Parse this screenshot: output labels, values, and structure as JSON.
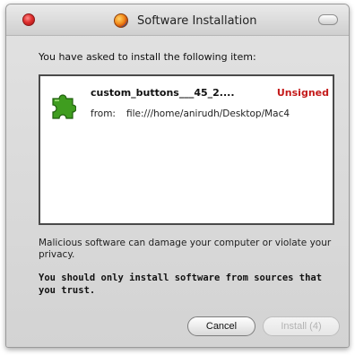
{
  "window": {
    "title": "Software Installation"
  },
  "prompt": "You have asked to install the following item:",
  "item": {
    "name": "custom_buttons___45_2....",
    "status": "Unsigned",
    "from_label": "from:",
    "from_value": "file:///home/anirudh/Desktop/Mac4"
  },
  "warning": "Malicious software can damage your computer or violate your privacy.",
  "advice": "You should only install software from sources that you trust.",
  "buttons": {
    "cancel": "Cancel",
    "install": "Install (4)"
  },
  "colors": {
    "unsigned": "#c41a1a",
    "close_button": "#e0302f",
    "addon_icon": "#3f9d1f"
  }
}
